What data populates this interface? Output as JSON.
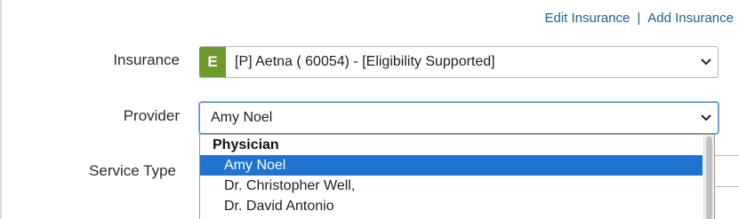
{
  "links": {
    "edit_insurance": "Edit Insurance",
    "separator": "|",
    "add_insurance": "Add Insurance"
  },
  "insurance": {
    "label": "Insurance",
    "badge": "E",
    "value": "[P] Aetna ( 60054) - [Eligibility Supported]",
    "badge_color": "#6e9a2a"
  },
  "provider": {
    "label": "Provider",
    "value": "Amy Noel",
    "dropdown": {
      "group": "Physician",
      "options": [
        "Amy Noel",
        "Dr. Christopher Well,",
        "Dr. David Antonio"
      ],
      "selected_index": 0,
      "highlight_color": "#1e74d0"
    }
  },
  "service_type": {
    "label": "Service Type"
  }
}
